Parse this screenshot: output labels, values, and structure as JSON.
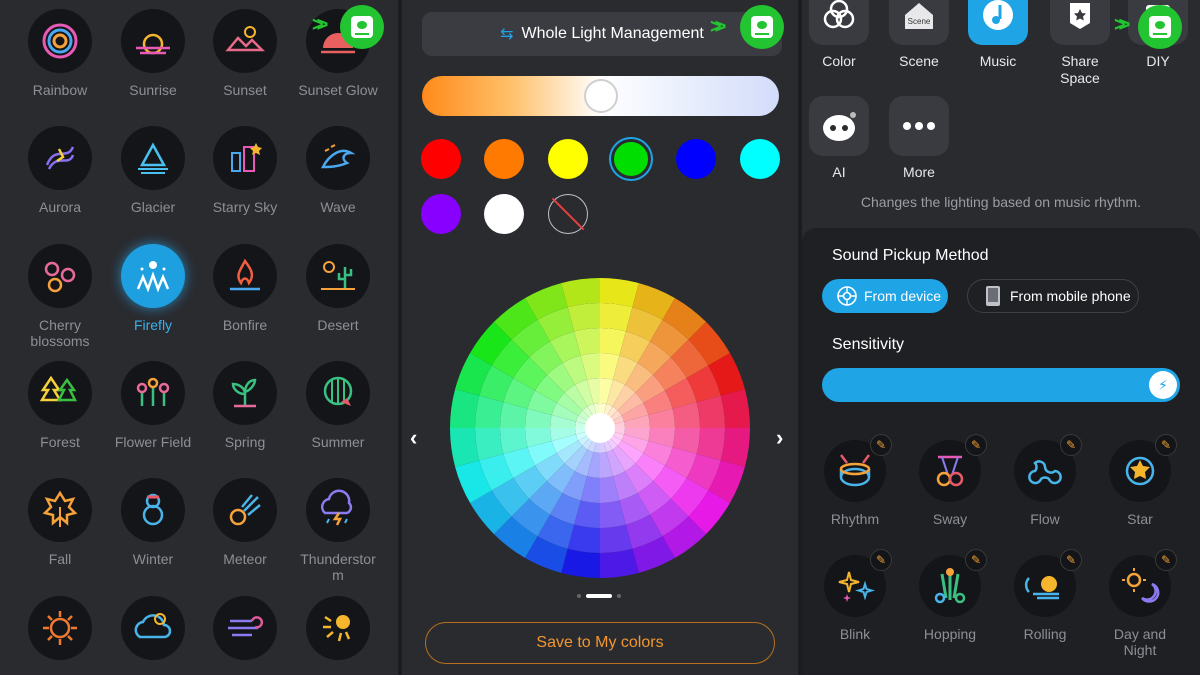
{
  "scenes": {
    "items": [
      {
        "label": "Rainbow"
      },
      {
        "label": "Sunrise"
      },
      {
        "label": "Sunset"
      },
      {
        "label": "Sunset Glow"
      },
      {
        "label": "Aurora"
      },
      {
        "label": "Glacier"
      },
      {
        "label": "Starry Sky"
      },
      {
        "label": "Wave"
      },
      {
        "label": "Cherry\nblossoms"
      },
      {
        "label": "Firefly"
      },
      {
        "label": "Bonfire"
      },
      {
        "label": "Desert"
      },
      {
        "label": "Forest"
      },
      {
        "label": "Flower Field"
      },
      {
        "label": "Spring"
      },
      {
        "label": "Summer"
      },
      {
        "label": "Fall"
      },
      {
        "label": "Winter"
      },
      {
        "label": "Meteor"
      },
      {
        "label": "Thunderstor\nm"
      }
    ],
    "active": "Firefly"
  },
  "color_panel": {
    "title": "Whole Light Management",
    "color_temperature_position": 0.5,
    "swatches": [
      "#ff0000",
      "#ff7a00",
      "#ffff00",
      "#00dd00",
      "#0000ff",
      "#00ffff",
      "#8800ff",
      "#ffffff",
      "none"
    ],
    "selected_swatch": "#00dd00",
    "save_label": "Save to My colors",
    "prev_icon": "chevron-left",
    "next_icon": "chevron-right"
  },
  "mode_panel": {
    "modes": [
      {
        "label": "Color",
        "icon": "color-circles-icon"
      },
      {
        "label": "Scene",
        "icon": "scene-icon"
      },
      {
        "label": "Music",
        "icon": "music-note-icon",
        "active": true
      },
      {
        "label": "Share\nSpace",
        "icon": "share-space-icon"
      },
      {
        "label": "DIY",
        "icon": "diy-icon"
      },
      {
        "label": "AI",
        "icon": "ai-robot-icon"
      },
      {
        "label": "More",
        "icon": "more-dots-icon"
      }
    ],
    "description": "Changes the lighting based on music rhythm.",
    "sound_pickup_title": "Sound Pickup Method",
    "from_device": "From device",
    "from_phone": "From mobile phone",
    "sensitivity_title": "Sensitivity",
    "sensitivity_value": 1.0,
    "effects": [
      {
        "label": "Rhythm"
      },
      {
        "label": "Sway"
      },
      {
        "label": "Flow"
      },
      {
        "label": "Star"
      },
      {
        "label": "Blink"
      },
      {
        "label": "Hopping"
      },
      {
        "label": "Rolling"
      },
      {
        "label": "Day and\nNight"
      }
    ]
  }
}
